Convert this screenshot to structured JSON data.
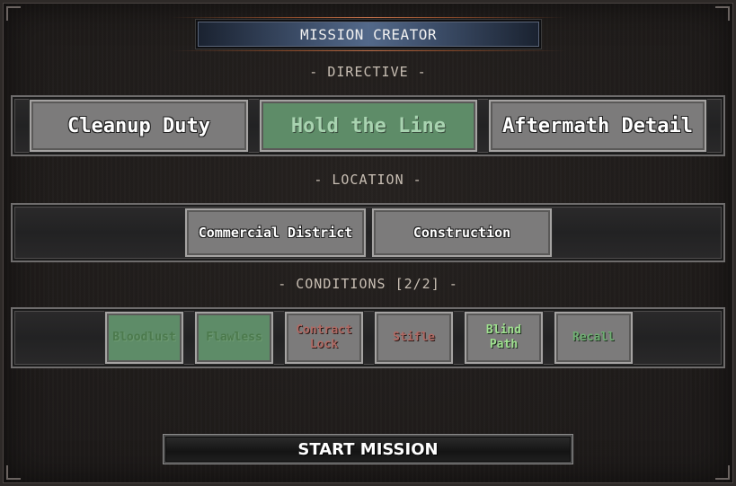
{
  "title": "MISSION CREATOR",
  "sections": {
    "directive": "- DIRECTIVE -",
    "location": "- LOCATION -",
    "conditions": "- CONDITIONS [2/2] -"
  },
  "directives": [
    {
      "label": "Cleanup Duty",
      "selected": false
    },
    {
      "label": "Hold the Line",
      "selected": true
    },
    {
      "label": "Aftermath Detail",
      "selected": false
    }
  ],
  "locations": [
    {
      "label": "Commercial District"
    },
    {
      "label": "Construction"
    }
  ],
  "conditions": [
    {
      "label": "Bloodlust",
      "active": true,
      "text_color": "#4c7a4d"
    },
    {
      "label": "Flawless",
      "active": true,
      "text_color": "#4c7a4d"
    },
    {
      "label": "Contract Lock",
      "active": false,
      "text_color": "#b06a64"
    },
    {
      "label": "Stifle",
      "active": false,
      "text_color": "#b06a64"
    },
    {
      "label": "Blind Path",
      "active": false,
      "text_color": "#9fe08f"
    },
    {
      "label": "Recall",
      "active": false,
      "text_color": "#6fae72"
    }
  ],
  "start_button": "START MISSION",
  "colors": {
    "selected": "#5e8c68",
    "button": "#7c7b7b",
    "background": "#1f1c1b"
  }
}
